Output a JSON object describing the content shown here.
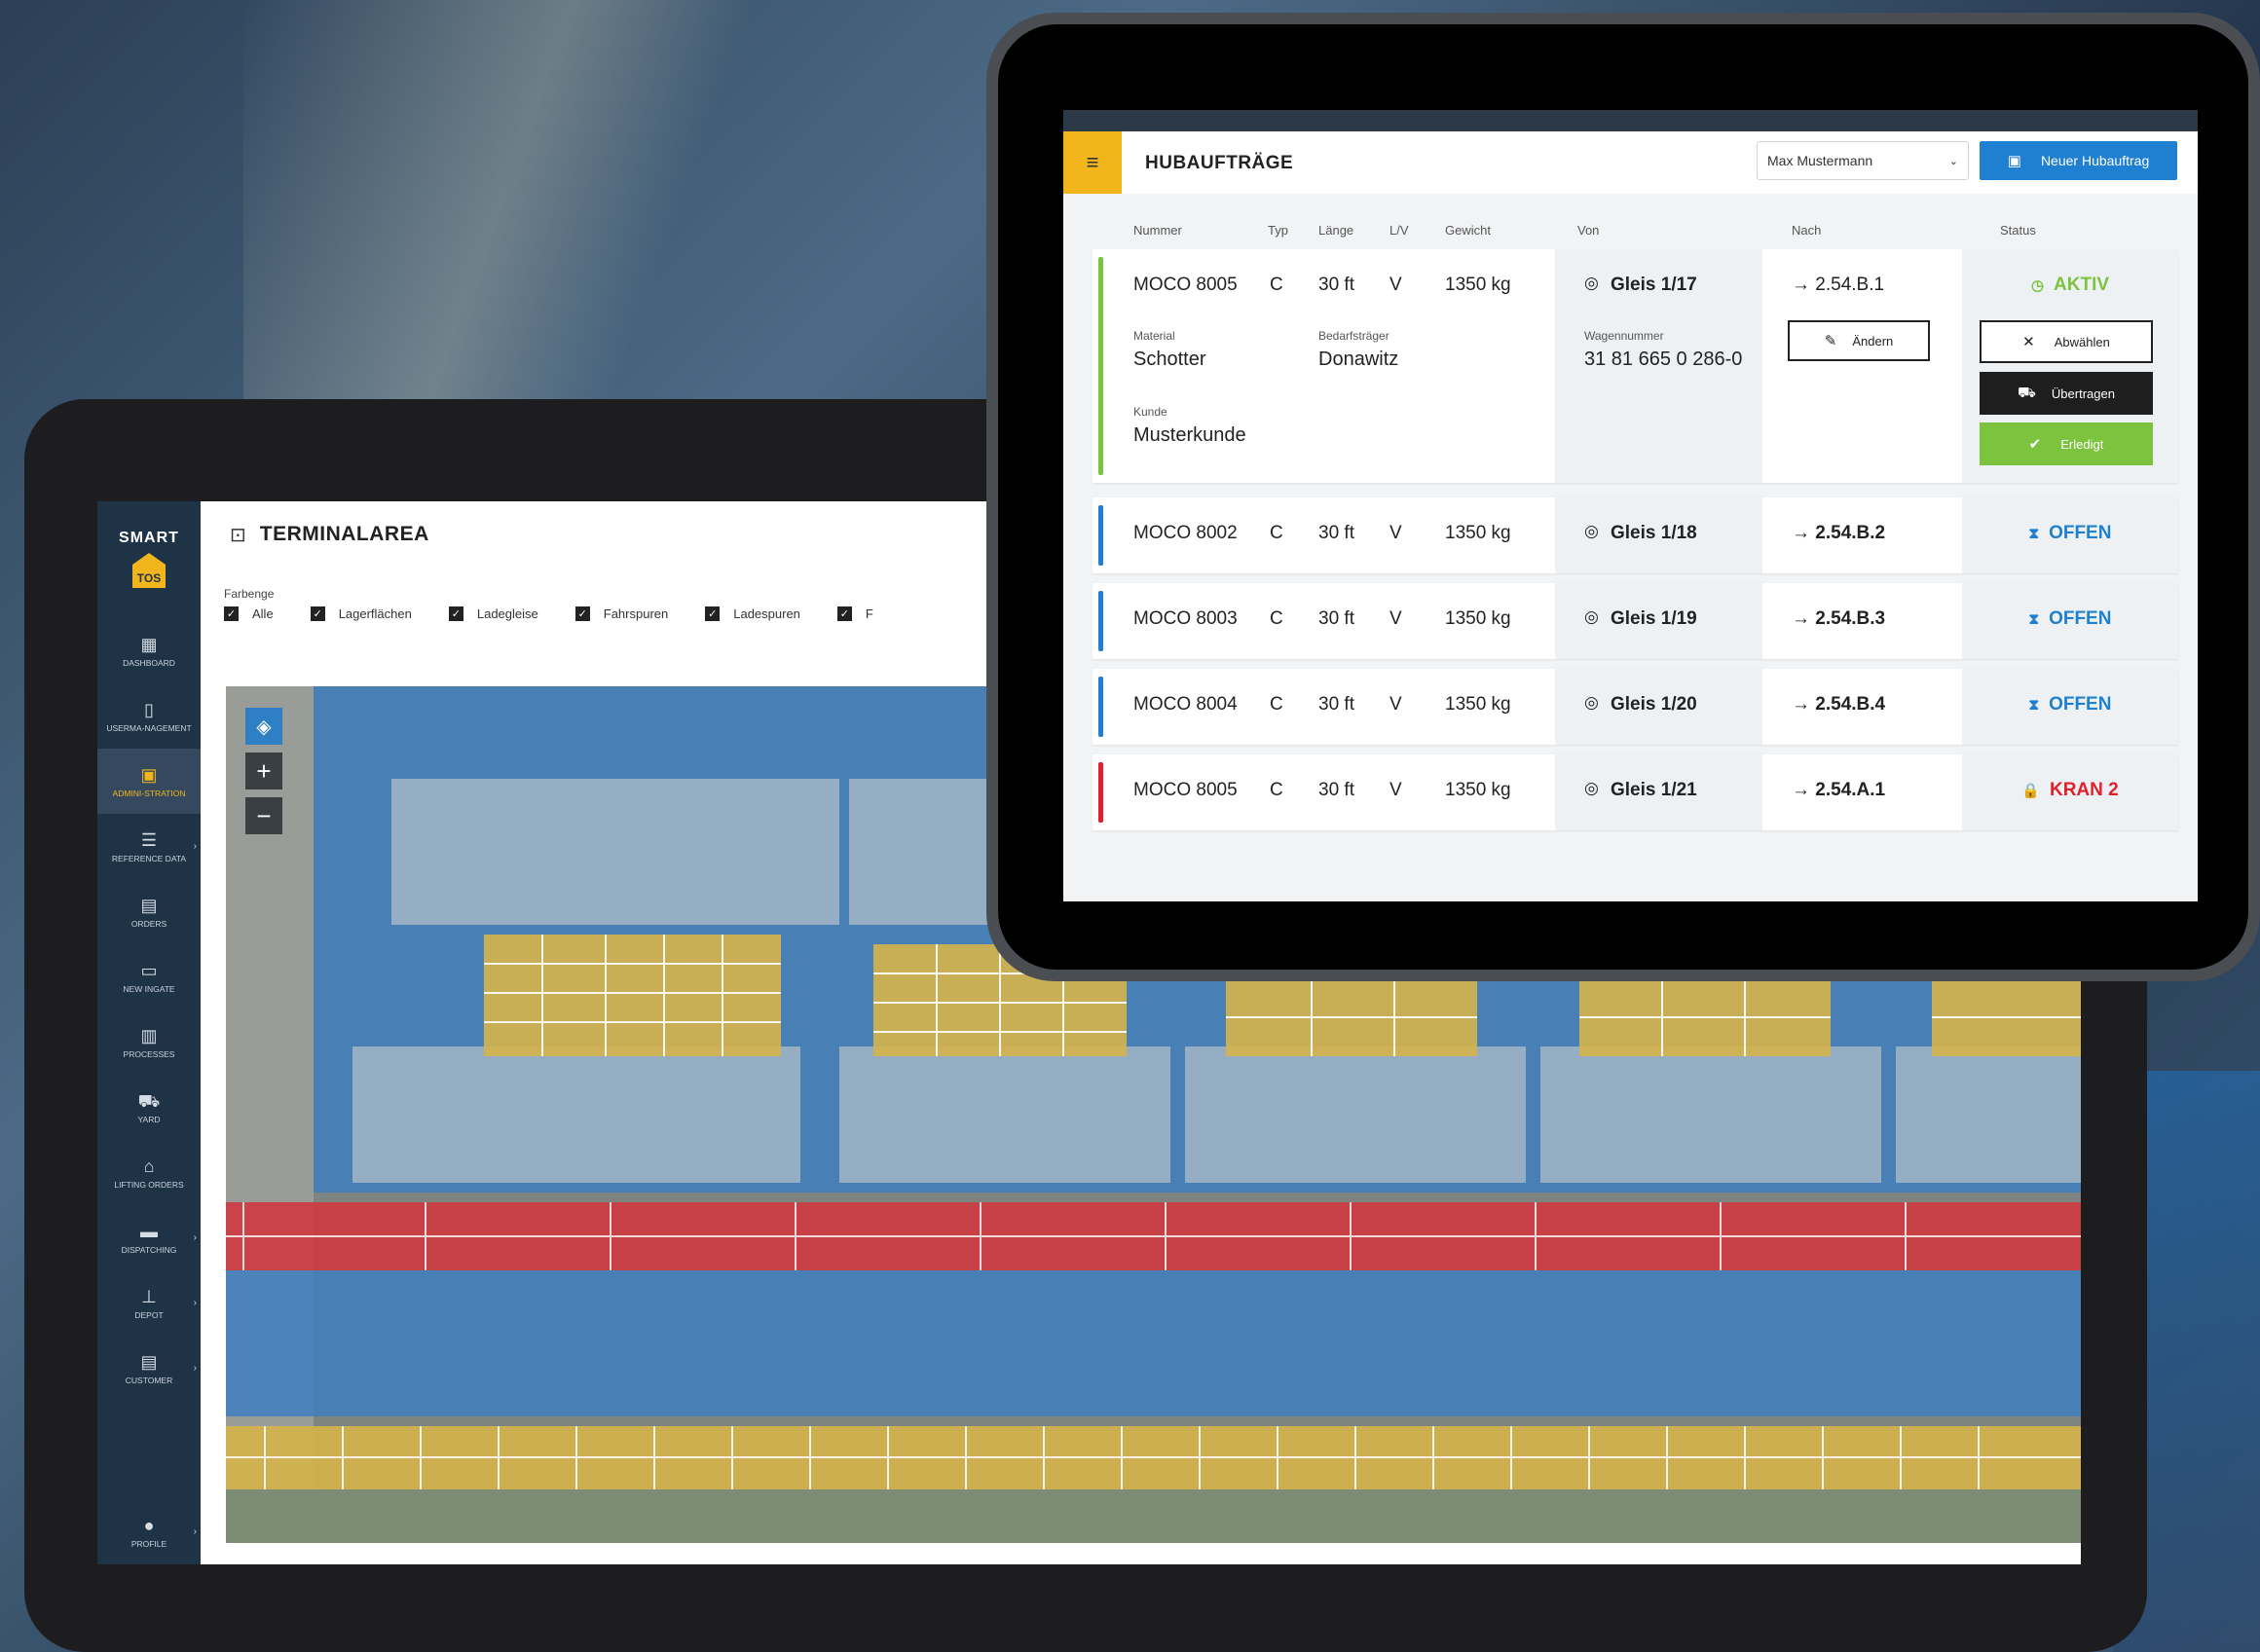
{
  "terminal_app": {
    "logo_line1": "SMART",
    "logo_line2": "TOS",
    "sidebar": [
      {
        "label": "DASHBOARD",
        "icon": "dashboard-icon"
      },
      {
        "label": "USERMA-NAGEMENT",
        "icon": "user-doc-icon"
      },
      {
        "label": "ADMINI-STRATION",
        "icon": "admin-icon",
        "active": true
      },
      {
        "label": "REFERENCE DATA",
        "icon": "database-icon",
        "chevron": true
      },
      {
        "label": "ORDERS",
        "icon": "orders-icon"
      },
      {
        "label": "NEW INGATE",
        "icon": "ingate-icon"
      },
      {
        "label": "PROCESSES",
        "icon": "processes-icon"
      },
      {
        "label": "YARD",
        "icon": "forklift-icon"
      },
      {
        "label": "LIFTING ORDERS",
        "icon": "lifting-icon"
      },
      {
        "label": "DISPATCHING",
        "icon": "dispatch-icon",
        "chevron": true
      },
      {
        "label": "DEPOT",
        "icon": "depot-icon",
        "chevron": true
      },
      {
        "label": "CUSTOMER",
        "icon": "customer-icon",
        "chevron": true
      },
      {
        "label": "PROFILE",
        "icon": "profile-icon",
        "chevron": true
      }
    ],
    "title": "TERMINALAREA",
    "filter_label": "Farbenge",
    "filters": [
      "Alle",
      "Lagerflächen",
      "Ladegleise",
      "Fahrspuren",
      "Ladespuren",
      "F"
    ]
  },
  "lift_app": {
    "title": "HUBAUFTRÄGE",
    "user": "Max Mustermann",
    "new_button": "Neuer Hubauftrag",
    "columns": [
      "Nummer",
      "Typ",
      "Länge",
      "L/V",
      "Gewicht",
      "Von",
      "Nach",
      "Status"
    ],
    "rows": [
      {
        "nummer": "MOCO 8005",
        "typ": "C",
        "laenge": "30 ft",
        "lv": "V",
        "gewicht": "1350 kg",
        "von": "Gleis 1/17",
        "nach": "→ 2.54.B.1",
        "status": "AKTIV",
        "status_color": "#7cc33e",
        "bar_color": "#7cc33e",
        "expanded": true
      },
      {
        "nummer": "MOCO 8002",
        "typ": "C",
        "laenge": "30 ft",
        "lv": "V",
        "gewicht": "1350 kg",
        "von": "Gleis 1/18",
        "nach": "→ 2.54.B.2",
        "status": "OFFEN",
        "status_color": "#1f7fd0",
        "bar_color": "#1f7fd0"
      },
      {
        "nummer": "MOCO 8003",
        "typ": "C",
        "laenge": "30 ft",
        "lv": "V",
        "gewicht": "1350 kg",
        "von": "Gleis 1/19",
        "nach": "→ 2.54.B.3",
        "status": "OFFEN",
        "status_color": "#1f7fd0",
        "bar_color": "#1f7fd0"
      },
      {
        "nummer": "MOCO 8004",
        "typ": "C",
        "laenge": "30 ft",
        "lv": "V",
        "gewicht": "1350 kg",
        "von": "Gleis 1/20",
        "nach": "→ 2.54.B.4",
        "status": "OFFEN",
        "status_color": "#1f7fd0",
        "bar_color": "#1f7fd0"
      },
      {
        "nummer": "MOCO 8005",
        "typ": "C",
        "laenge": "30 ft",
        "lv": "V",
        "gewicht": "1350 kg",
        "von": "Gleis 1/21",
        "nach": "→ 2.54.A.1",
        "status": "KRAN 2",
        "status_color": "#e0202a",
        "bar_color": "#e0202a"
      }
    ],
    "detail": {
      "material_label": "Material",
      "material": "Schotter",
      "bedarf_label": "Bedarfsträger",
      "bedarf": "Donawitz",
      "kunde_label": "Kunde",
      "kunde": "Musterkunde",
      "wagen_label": "Wagennummer",
      "wagen": "31 81 665 0 286-0",
      "aendern": "Ändern",
      "abwaehlen": "Abwählen",
      "uebertragen": "Übertragen",
      "erledigt": "Erledigt"
    }
  }
}
